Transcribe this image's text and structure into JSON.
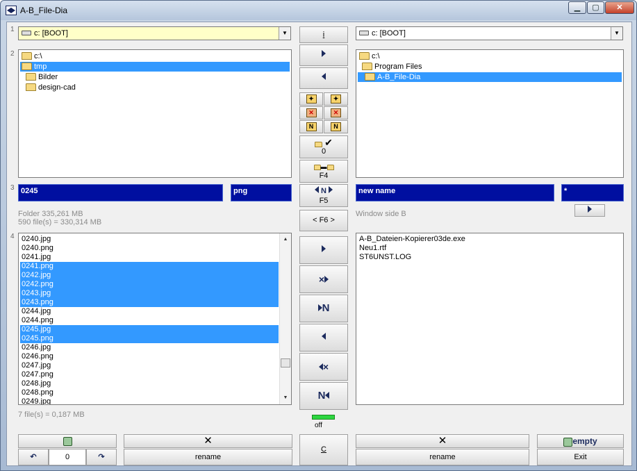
{
  "window": {
    "title": "A-B_File-Dia",
    "min": "▁",
    "max": "▢",
    "close": "✕"
  },
  "row_numbers": [
    "1",
    "2",
    "3",
    "4"
  ],
  "left": {
    "drive": "c: [BOOT]",
    "tree": [
      {
        "label": "c:\\",
        "selected": false,
        "indent": 0
      },
      {
        "label": "tmp",
        "selected": true,
        "indent": 1
      },
      {
        "label": "Bilder",
        "selected": false,
        "indent": 1
      },
      {
        "label": "design-cad",
        "selected": false,
        "indent": 1
      }
    ],
    "name_field": "0245",
    "ext_field": "png",
    "folder_info": "Folder 335,261  MB",
    "files_info": "590  file(s) = 330,314  MB",
    "files": [
      {
        "name": "0240.jpg",
        "selected": false
      },
      {
        "name": "0240.png",
        "selected": false
      },
      {
        "name": "0241.jpg",
        "selected": false
      },
      {
        "name": "0241.png",
        "selected": true
      },
      {
        "name": "0242.jpg",
        "selected": true
      },
      {
        "name": "0242.png",
        "selected": true
      },
      {
        "name": "0243.jpg",
        "selected": true
      },
      {
        "name": "0243.png",
        "selected": true
      },
      {
        "name": "0244.jpg",
        "selected": false
      },
      {
        "name": "0244.png",
        "selected": false
      },
      {
        "name": "0245.jpg",
        "selected": true
      },
      {
        "name": "0245.png",
        "selected": true
      },
      {
        "name": "0246.jpg",
        "selected": false
      },
      {
        "name": "0246.png",
        "selected": false
      },
      {
        "name": "0247.jpg",
        "selected": false
      },
      {
        "name": "0247.png",
        "selected": false
      },
      {
        "name": "0248.jpg",
        "selected": false
      },
      {
        "name": "0248.png",
        "selected": false
      },
      {
        "name": "0249.jpg",
        "selected": false
      }
    ],
    "sel_info": "7  file(s) = 0,187  MB",
    "counter": "0",
    "undo_icon": "↶",
    "redo_icon": "↷",
    "rename": "rename",
    "delete_icon": "✕",
    "recycle_icon": "recycle-bin-icon"
  },
  "middle": {
    "info_btn": "i",
    "tree_copy_right": "copy-folder-right-icon",
    "tree_copy_left": "copy-folder-left-icon",
    "check_count": "0",
    "f4": "F4",
    "f5": "F5",
    "f6": "< F6 >",
    "n_label": "N",
    "x_label": "×",
    "c_button": "C",
    "led_label": "off"
  },
  "right": {
    "drive": "c: [BOOT]",
    "tree": [
      {
        "label": "c:\\",
        "selected": false,
        "indent": 0
      },
      {
        "label": "Program Files",
        "selected": false,
        "indent": 1
      },
      {
        "label": "A-B_File-Dia",
        "selected": true,
        "indent": 2
      }
    ],
    "name_field": "new name",
    "ext_field": "*",
    "window_label": "Window side B",
    "files": [
      {
        "name": "A-B_Dateien-Kopierer03de.exe",
        "selected": false
      },
      {
        "name": "Neu1.rtf",
        "selected": false
      },
      {
        "name": "ST6UNST.LOG",
        "selected": false
      }
    ],
    "rename": "rename",
    "empty": "empty",
    "exit": "Exit",
    "delete_icon": "✕"
  }
}
